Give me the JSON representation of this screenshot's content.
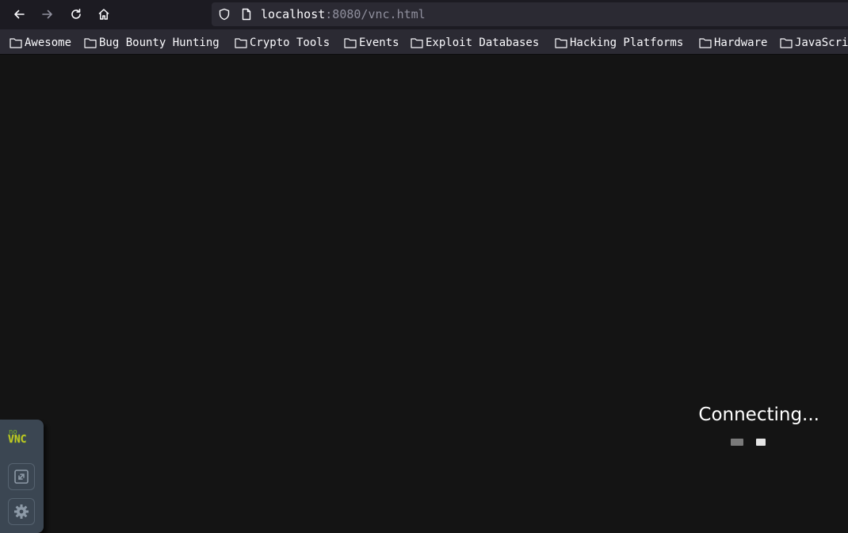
{
  "browser": {
    "url_host": "localhost",
    "url_rest": ":8080/vnc.html",
    "icons": [
      "back-icon",
      "forward-icon",
      "reload-icon",
      "home-icon",
      "shield-icon",
      "page-icon"
    ]
  },
  "bookmarks": [
    {
      "label": "Awesome"
    },
    {
      "label": "Bug Bounty Hunting"
    },
    {
      "label": "Crypto Tools"
    },
    {
      "label": "Events"
    },
    {
      "label": "Exploit Databases"
    },
    {
      "label": "Hacking Platforms"
    },
    {
      "label": "Hardware"
    },
    {
      "label": "JavaScri"
    }
  ],
  "novnc": {
    "logo_top": "no",
    "logo_bottom": "VNC",
    "status": "Connecting...",
    "control_icons": [
      "fullscreen-icon",
      "settings-gear-icon"
    ]
  },
  "colors": {
    "background": "#141414",
    "toolbar": "#1c1b22",
    "bookmarks_bar": "#2b2a33",
    "control_bar": "#3b4652",
    "logo_green": "#78b12a",
    "logo_yellow": "#d7c522"
  }
}
